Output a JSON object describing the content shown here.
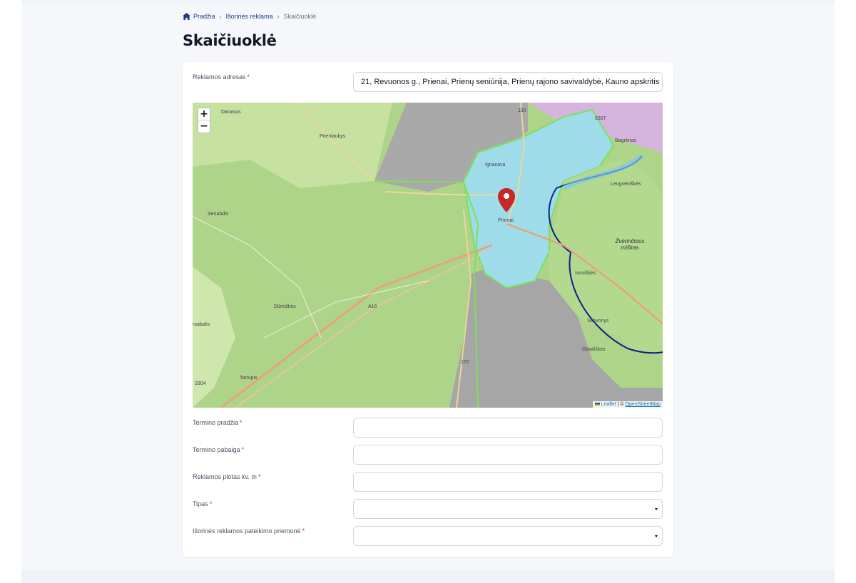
{
  "breadcrumb": {
    "items": [
      {
        "label": "Pradžia"
      },
      {
        "label": "Išorinės reklama"
      },
      {
        "label": "Skaičiuoklė"
      }
    ]
  },
  "page": {
    "title": "Skaičiuoklė"
  },
  "form": {
    "address": {
      "label": "Reklamos adresas",
      "value": "21, Revuonos g., Prienai, Prienų seniūnija, Prienų rajono savivaldybė, Kauno apskritis, 59125, Lietuva"
    },
    "term_start": {
      "label": "Termino pradžia",
      "value": ""
    },
    "term_end": {
      "label": "Termino pabaiga",
      "value": ""
    },
    "area": {
      "label": "Reklamos plotas kv. m",
      "value": ""
    },
    "type": {
      "label": "Tipas",
      "value": ""
    },
    "medium": {
      "label": "Išorinės reklamos pateikimo priemonė",
      "value": ""
    },
    "required_mark": "*"
  },
  "map": {
    "zoom_in": "+",
    "zoom_out": "−",
    "attribution": {
      "leaflet": "Leaflet",
      "separator": "| ©",
      "osm": "OpenStreetMap"
    },
    "labels": {
      "daraisos": "Daraisos",
      "prienlaukys": "Prienlaukys",
      "ignacava": "Ignacava",
      "bagrenas": "Bagrėnas",
      "lengvenis": "Lengvėniškės",
      "senadis": "Senaūdis",
      "prienai": "Prienai",
      "zverincius": "Žvėrinčious miškas",
      "ivoniskes": "Ivoniškės",
      "dumiskes": "Dūmiškės",
      "rsabalis": "rsabalis",
      "skevonys": "Skėvonys",
      "giraitiskes": "Giraitiškes",
      "tartupis": "Tartupis",
      "road_a16": "A16",
      "road_130": "130",
      "road_3307": "3307",
      "road_170": "170",
      "road_3304": "3304"
    }
  },
  "colors": {
    "accent": "#1e3a8a",
    "required": "#dc2626",
    "forest": "#a6d07a",
    "urban": "#aad3df",
    "river_border": "#0b1f8a",
    "marker": "#c62828"
  }
}
